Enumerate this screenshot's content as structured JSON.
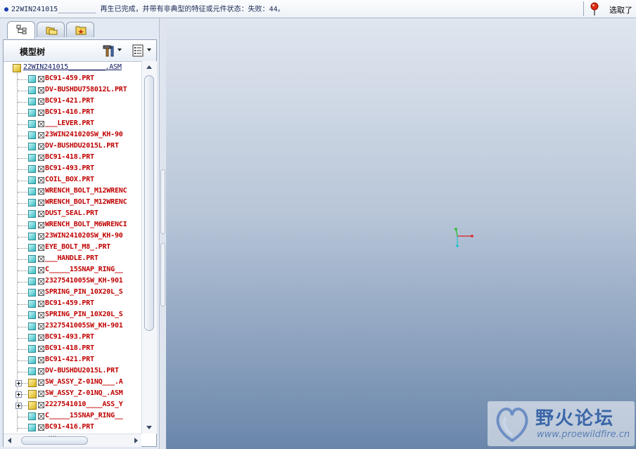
{
  "message_bar": {
    "message": "22WIN241015_________ 再生已完成，并带有非典型的特征或元件状态：失败：44。",
    "select_label": "选取了"
  },
  "navigator": {
    "tabs": [
      {
        "name": "model-tree-tab",
        "icon": "model-tree-icon",
        "active": true
      },
      {
        "name": "folder-browser-tab",
        "icon": "folders-icon",
        "active": false
      },
      {
        "name": "favorites-tab",
        "icon": "favorites-folder-icon",
        "active": false
      }
    ],
    "panel_title": "模型树",
    "tools": [
      "settings-hammer-icon",
      "show-list-icon"
    ]
  },
  "model_tree": {
    "root": "22WIN241015_________.ASM",
    "items": [
      {
        "label": "BC91-459.PRT",
        "type": "part"
      },
      {
        "label": "DV-BUSHDU758012L.PRT",
        "type": "part"
      },
      {
        "label": "BC91-421.PRT",
        "type": "part"
      },
      {
        "label": "BC91-416.PRT",
        "type": "part"
      },
      {
        "label": "___LEVER.PRT",
        "type": "part"
      },
      {
        "label": "23WIN241020SW_KH-90",
        "type": "part"
      },
      {
        "label": "DV-BUSHDU2015L.PRT",
        "type": "part"
      },
      {
        "label": "BC91-418.PRT",
        "type": "part"
      },
      {
        "label": "BC91-493.PRT",
        "type": "part"
      },
      {
        "label": "COIL_BOX.PRT",
        "type": "part"
      },
      {
        "label": "WRENCH_BOLT_M12WRENC",
        "type": "part"
      },
      {
        "label": "WRENCH_BOLT_M12WRENC",
        "type": "part"
      },
      {
        "label": "DUST_SEAL.PRT",
        "type": "part"
      },
      {
        "label": "WRENCH_BOLT_M6WRENCI",
        "type": "part"
      },
      {
        "label": "23WIN241020SW_KH-90",
        "type": "part"
      },
      {
        "label": "EYE_BOLT_M8_.PRT",
        "type": "part"
      },
      {
        "label": "___HANDLE.PRT",
        "type": "part"
      },
      {
        "label": "C_____15SNAP_RING__",
        "type": "part"
      },
      {
        "label": "2327541005SW_KH-901",
        "type": "part"
      },
      {
        "label": "SPRING_PIN_10X20L_S",
        "type": "part"
      },
      {
        "label": "BC91-459.PRT",
        "type": "part"
      },
      {
        "label": "SPRING_PIN_10X20L_S",
        "type": "part"
      },
      {
        "label": "2327541005SW_KH-901",
        "type": "part"
      },
      {
        "label": "BC91-493.PRT",
        "type": "part"
      },
      {
        "label": "BC91-418.PRT",
        "type": "part"
      },
      {
        "label": "BC91-421.PRT",
        "type": "part"
      },
      {
        "label": "DV-BUSHDU2015L.PRT",
        "type": "part"
      },
      {
        "label": "SW_ASSY_Z-01NQ___.A",
        "type": "assembly"
      },
      {
        "label": "SW_ASSY_Z-01NQ_.ASM",
        "type": "assembly"
      },
      {
        "label": "2227541010____ASS_Y",
        "type": "assembly"
      },
      {
        "label": "C_____15SNAP_RING__",
        "type": "part"
      },
      {
        "label": "BC91-416.PRT",
        "type": "part"
      }
    ],
    "horizontal_scroll_grip": "····"
  },
  "watermark": {
    "title": "野火论坛",
    "url": "www.proewildfire.cn"
  },
  "colors": {
    "failed_item_text": "#c00000",
    "root_text": "#0d1a60",
    "viewport_top": "#e0e6ef",
    "viewport_bottom": "#6a86ab",
    "triad_x": "#e02020",
    "triad_y": "#20c020",
    "triad_z": "#20c0d0"
  }
}
